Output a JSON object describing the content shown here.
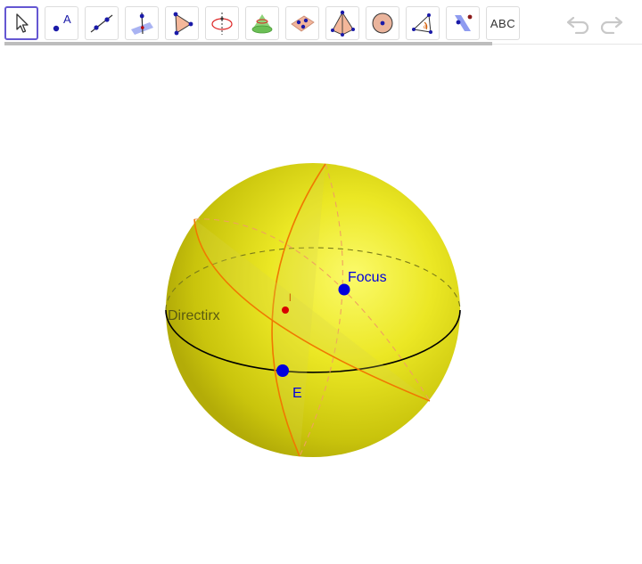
{
  "toolbar": {
    "tools": [
      {
        "name": "move-tool",
        "icon": "cursor-arrow-icon",
        "selected": true
      },
      {
        "name": "point-tool",
        "icon": "point-icon",
        "label": "A"
      },
      {
        "name": "line-tool",
        "icon": "line-through-two-points-icon"
      },
      {
        "name": "perpendicular-line-tool",
        "icon": "perpendicular-line-icon"
      },
      {
        "name": "polygon-tool",
        "icon": "polygon-icon"
      },
      {
        "name": "circle-tool",
        "icon": "circle-axis-icon"
      },
      {
        "name": "cone-tool",
        "icon": "cone-icon"
      },
      {
        "name": "plane-tool",
        "icon": "plane-through-three-points-icon"
      },
      {
        "name": "pyramid-tool",
        "icon": "pyramid-icon"
      },
      {
        "name": "sphere-tool",
        "icon": "sphere-icon"
      },
      {
        "name": "angle-tool",
        "icon": "angle-icon"
      },
      {
        "name": "reflect-tool",
        "icon": "reflect-about-plane-icon"
      },
      {
        "name": "text-tool",
        "icon": "text-icon",
        "label": "ABC"
      }
    ],
    "undo_icon": "undo-icon",
    "redo_icon": "redo-icon"
  },
  "scene": {
    "sphere_color": "#e8e417",
    "curve_color": "#f07800",
    "equator_color": "#000000",
    "point_color": "#0000dd",
    "labels": {
      "focus": "Focus",
      "e": "E",
      "directrix": "Directirx",
      "mark": "l"
    }
  }
}
